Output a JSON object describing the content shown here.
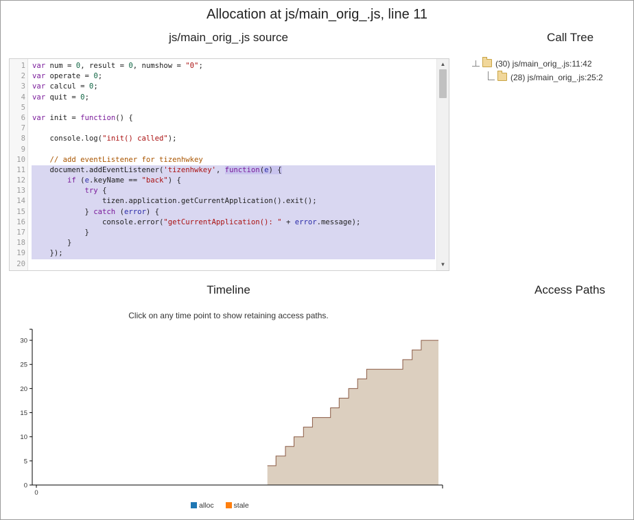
{
  "page": {
    "title": "Allocation at js/main_orig_.js, line 11"
  },
  "source": {
    "title": "js/main_orig_.js source",
    "highlight_lines": [
      11,
      12,
      13,
      14,
      15,
      16,
      17,
      18,
      19
    ],
    "lines": [
      {
        "n": "1",
        "html": "<span class=\"kw\">var</span> num = <span class=\"num\">0</span>, result = <span class=\"num\">0</span>, numshow = <span class=\"str\">\"0\"</span>;"
      },
      {
        "n": "2",
        "html": "<span class=\"kw\">var</span> operate = <span class=\"num\">0</span>;"
      },
      {
        "n": "3",
        "html": "<span class=\"kw\">var</span> calcul = <span class=\"num\">0</span>;"
      },
      {
        "n": "4",
        "html": "<span class=\"kw\">var</span> quit = <span class=\"num\">0</span>;"
      },
      {
        "n": "5",
        "html": ""
      },
      {
        "n": "6",
        "html": "<span class=\"kw\">var</span> init = <span class=\"kw\">function</span>() {"
      },
      {
        "n": "7",
        "html": ""
      },
      {
        "n": "8",
        "html": "    console.log(<span class=\"str\">\"init() called\"</span>);"
      },
      {
        "n": "9",
        "html": ""
      },
      {
        "n": "10",
        "html": "    <span class=\"cm\">// add eventListener for tizenhwkey</span>"
      },
      {
        "n": "11",
        "html": "    document.addEventListener(<span class=\"str\">'tizenhwkey'</span>, <span class=\"hlfn\"><span class=\"kw\">function</span>(<span class=\"var2\">e</span>) {</span>"
      },
      {
        "n": "12",
        "html": "        <span class=\"kw\">if</span> (<span class=\"var2\">e</span>.keyName == <span class=\"str\">\"back\"</span>) {"
      },
      {
        "n": "13",
        "html": "            <span class=\"kw\">try</span> {"
      },
      {
        "n": "14",
        "html": "                tizen.application.getCurrentApplication().exit();"
      },
      {
        "n": "15",
        "html": "            } <span class=\"kw\">catch</span> (<span class=\"var2\">error</span>) {"
      },
      {
        "n": "16",
        "html": "                console.error(<span class=\"str\">\"getCurrentApplication(): \"</span> + <span class=\"var2\">error</span>.message);"
      },
      {
        "n": "17",
        "html": "            }"
      },
      {
        "n": "18",
        "html": "        }"
      },
      {
        "n": "19",
        "html": "    });"
      },
      {
        "n": "20",
        "html": ""
      }
    ]
  },
  "call_tree": {
    "title": "Call Tree",
    "nodes": [
      {
        "label": "(30) js/main_orig_.js:11:42",
        "depth": 0
      },
      {
        "label": "(28) js/main_orig_.js:25:2",
        "depth": 1
      }
    ]
  },
  "timeline": {
    "title": "Timeline",
    "hint": "Click on any time point to show retaining access paths."
  },
  "access_paths": {
    "title": "Access Paths"
  },
  "chart_data": {
    "type": "area",
    "title": "",
    "xlabel": "",
    "ylabel": "",
    "x_tick_labels": [
      "0"
    ],
    "y_ticks": [
      0,
      5,
      10,
      15,
      20,
      25,
      30
    ],
    "ylim": [
      0,
      32
    ],
    "xlim": [
      0,
      100
    ],
    "grid": false,
    "legend_position": "bottom",
    "series": [
      {
        "name": "alloc",
        "color": "#1f77b4",
        "points": []
      },
      {
        "name": "stale",
        "color": "#ff7f0e",
        "points": []
      }
    ],
    "total_points": [
      [
        0,
        0
      ],
      [
        57.3,
        0
      ],
      [
        57.3,
        4
      ],
      [
        59.4,
        4
      ],
      [
        59.4,
        6
      ],
      [
        61.7,
        6
      ],
      [
        61.7,
        8
      ],
      [
        63.8,
        8
      ],
      [
        63.8,
        10
      ],
      [
        66.1,
        10
      ],
      [
        66.1,
        12
      ],
      [
        68.3,
        12
      ],
      [
        68.3,
        14
      ],
      [
        72.7,
        14
      ],
      [
        72.7,
        16
      ],
      [
        74.8,
        16
      ],
      [
        74.8,
        18
      ],
      [
        77.1,
        18
      ],
      [
        77.1,
        20
      ],
      [
        79.3,
        20
      ],
      [
        79.3,
        22
      ],
      [
        81.5,
        22
      ],
      [
        81.5,
        24
      ],
      [
        90.3,
        24
      ],
      [
        90.3,
        26
      ],
      [
        92.6,
        26
      ],
      [
        92.6,
        28
      ],
      [
        94.8,
        28
      ],
      [
        94.8,
        30
      ],
      [
        99,
        30
      ]
    ],
    "fill_color": "#dccfbf",
    "stroke_color": "#8a5a44"
  }
}
